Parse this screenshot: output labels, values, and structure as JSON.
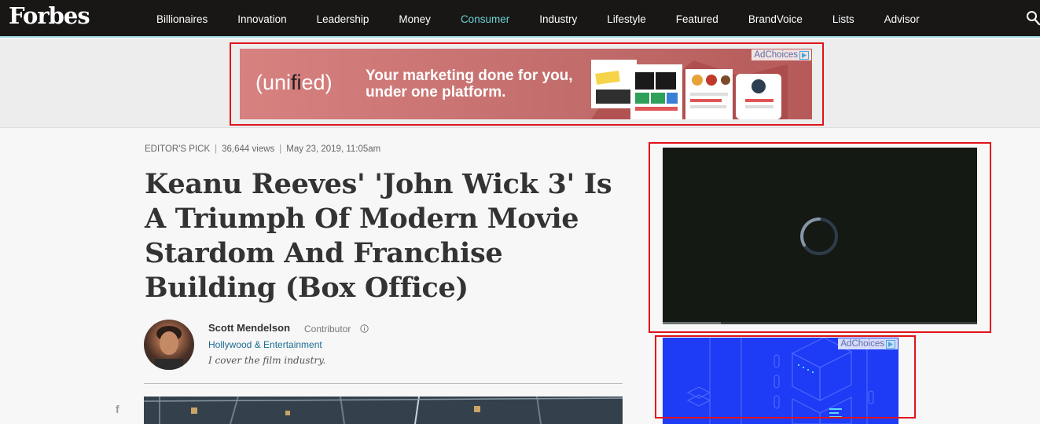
{
  "nav": {
    "logo": "Forbes",
    "items": [
      {
        "label": "Billionaires",
        "active": false
      },
      {
        "label": "Innovation",
        "active": false
      },
      {
        "label": "Leadership",
        "active": false
      },
      {
        "label": "Money",
        "active": false
      },
      {
        "label": "Consumer",
        "active": true
      },
      {
        "label": "Industry",
        "active": false
      },
      {
        "label": "Lifestyle",
        "active": false
      },
      {
        "label": "Featured",
        "active": false
      },
      {
        "label": "BrandVoice",
        "active": false
      },
      {
        "label": "Lists",
        "active": false
      },
      {
        "label": "Advisor",
        "active": false
      }
    ],
    "search_icon": "search-icon"
  },
  "top_ad": {
    "brand_prefix": "(uni",
    "brand_fi": "fi",
    "brand_suffix": "ed)",
    "tagline": "Your marketing done for you, under one platform.",
    "adchoices": "AdChoices"
  },
  "article": {
    "kicker": "EDITOR'S PICK",
    "views": "36,644 views",
    "date": "May 23, 2019, 11:05am",
    "title": "Keanu Reeves' 'John Wick 3' Is A Triumph Of Modern Movie Stardom And Franchise Building (Box Office)",
    "author": {
      "name": "Scott Mendelson",
      "role": "Contributor",
      "section": "Hollywood & Entertainment",
      "bio": "I cover the film industry."
    },
    "share_icon": "facebook-icon"
  },
  "video": {
    "progress": 0.185
  },
  "side_ad": {
    "adchoices": "AdChoices"
  },
  "colors": {
    "nav_bg": "#181716",
    "nav_active": "#6ed0d4",
    "highlight": "#e2121c",
    "link": "#1b6c93",
    "side_ad_bg": "#1e3bf5",
    "video_bg": "#141914"
  }
}
